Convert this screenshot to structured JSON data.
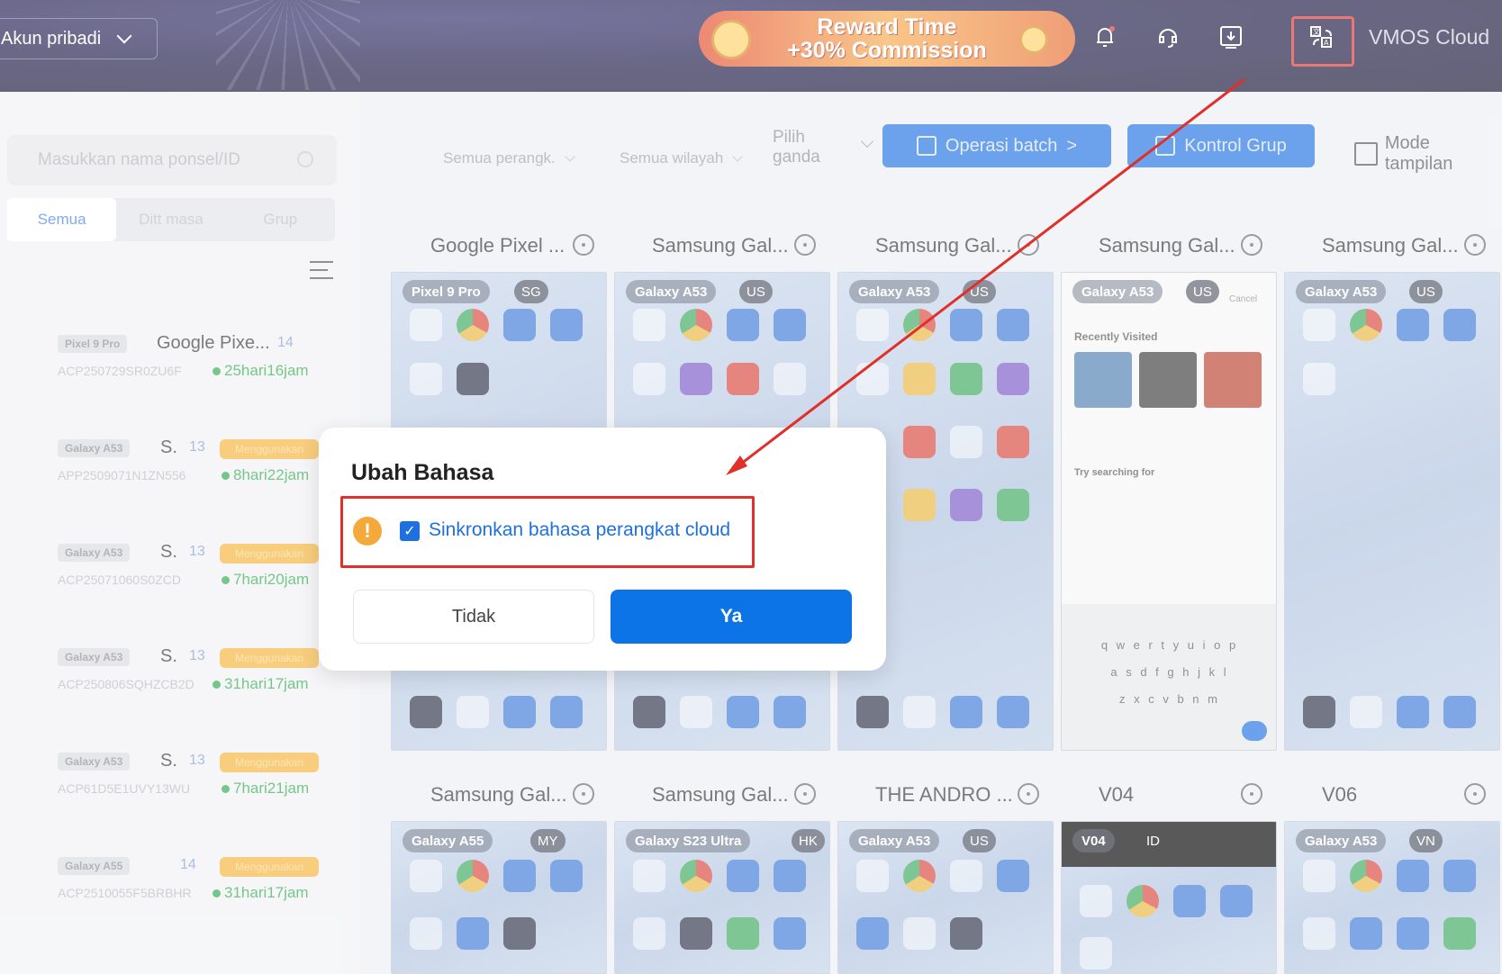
{
  "header": {
    "account_label": "Akun pribadi",
    "reward_line1": "Reward Time",
    "reward_line2": "+30% Commission",
    "brand": "VMOS Cloud",
    "icons": [
      "bell-icon",
      "support-icon",
      "download-icon",
      "translate-icon"
    ]
  },
  "sidebar": {
    "search_placeholder": "Masukkan nama ponsel/ID",
    "segments": [
      "Semua",
      "Ditt masa",
      "Grup"
    ],
    "devices": [
      {
        "chip": "Pixel 9 Pro",
        "name": "Google Pixe...",
        "count": "14",
        "badge": "",
        "id": "ACP250729SR0ZU6F",
        "time": "25hari16jam"
      },
      {
        "chip": "Galaxy A53",
        "name": "S.",
        "count": "13",
        "badge": "Menggunakan",
        "id": "APP2509071N1ZN556",
        "time": "8hari22jam"
      },
      {
        "chip": "Galaxy A53",
        "name": "S.",
        "count": "13",
        "badge": "Menggunakan",
        "id": "ACP25071060S0ZCD",
        "time": "7hari20jam"
      },
      {
        "chip": "Galaxy A53",
        "name": "S.",
        "count": "13",
        "badge": "Menggunakan",
        "id": "ACP250806SQHZCB2D",
        "time": "31hari17jam"
      },
      {
        "chip": "Galaxy A53",
        "name": "S.",
        "count": "13",
        "badge": "Menggunakan",
        "id": "ACP61D5E1UVY13WU",
        "time": "7hari21jam"
      },
      {
        "chip": "Galaxy A55",
        "name": "",
        "count": "14",
        "badge": "Menggunakan",
        "id": "ACP2510055F5BRBHR",
        "time": "31hari17jam"
      }
    ]
  },
  "toolbar": {
    "filter_devices": "Semua perangk.",
    "filter_region": "Semua wilayah",
    "multi_select_line1": "Pilih",
    "multi_select_line2": "ganda",
    "batch_label": "Operasi batch",
    "group_label": "Kontrol Grup",
    "view_mode": "Mode tampilan"
  },
  "cards_row1": [
    {
      "title": "Google Pixel ...",
      "tag": "Pixel 9 Pro",
      "cc": "SG"
    },
    {
      "title": "Samsung Gal...",
      "tag": "Galaxy A53",
      "cc": "US"
    },
    {
      "title": "Samsung Gal...",
      "tag": "Galaxy A53",
      "cc": "US"
    },
    {
      "title": "Samsung Gal...",
      "tag": "Galaxy A53",
      "cc": "US"
    },
    {
      "title": "Samsung Gal...",
      "tag": "Galaxy A53",
      "cc": "US"
    }
  ],
  "cards_row2": [
    {
      "title": "Samsung Gal...",
      "tag": "Galaxy A55",
      "cc": "MY"
    },
    {
      "title": "Samsung Gal...",
      "tag": "Galaxy S23 Ultra",
      "cc": "HK"
    },
    {
      "title": "THE ANDRO ...",
      "tag": "Galaxy A53",
      "cc": "US"
    },
    {
      "title": "V04",
      "tag": "V04",
      "cc": "ID"
    },
    {
      "title": "V06",
      "tag": "Galaxy A53",
      "cc": "VN"
    }
  ],
  "browser_screen": {
    "recently_visited": "Recently Visited",
    "try_searching": "Try searching for",
    "cancel": "Cancel",
    "keyboard_row1": "q w e r t y u i o p",
    "keyboard_row2": "a s d f g h j k l",
    "keyboard_row3": "z x c v b n m"
  },
  "dialog": {
    "title": "Ubah Bahasa",
    "checkbox_label": "Sinkronkan bahasa perangkat cloud",
    "checked": true,
    "no_label": "Tidak",
    "yes_label": "Ya"
  },
  "colors": {
    "primary": "#1e6fe0",
    "highlight": "#e0302a",
    "warning": "#f6a93b",
    "online": "#2aaa4a"
  }
}
